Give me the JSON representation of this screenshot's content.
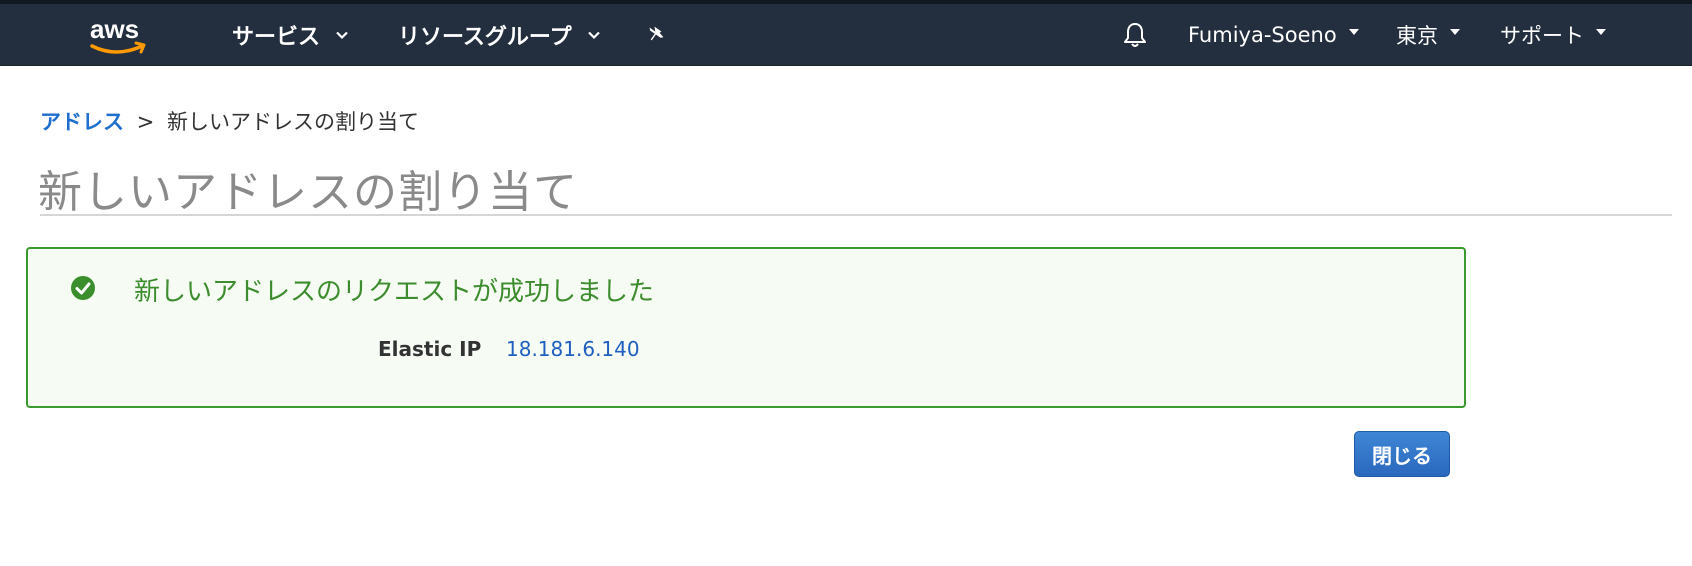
{
  "nav": {
    "logo_text": "aws",
    "services_label": "サービス",
    "resource_groups_label": "リソースグループ",
    "pin_icon": "pin-icon",
    "bell_icon": "bell-icon",
    "account_label": "Fumiya-Soeno",
    "region_label": "東京",
    "support_label": "サポート"
  },
  "breadcrumb": {
    "parent": "アドレス",
    "separator": ">",
    "current": "新しいアドレスの割り当て"
  },
  "page": {
    "title": "新しいアドレスの割り当て"
  },
  "success": {
    "icon": "check-circle-icon",
    "message": "新しいアドレスのリクエストが成功しました",
    "eip_label": "Elastic IP",
    "eip_value": "18.181.6.140"
  },
  "actions": {
    "close_label": "閉じる"
  },
  "colors": {
    "nav_bg": "#232f3e",
    "link_blue": "#1f6fce",
    "success_green": "#3d8d2e",
    "button_blue": "#2f74c8"
  }
}
